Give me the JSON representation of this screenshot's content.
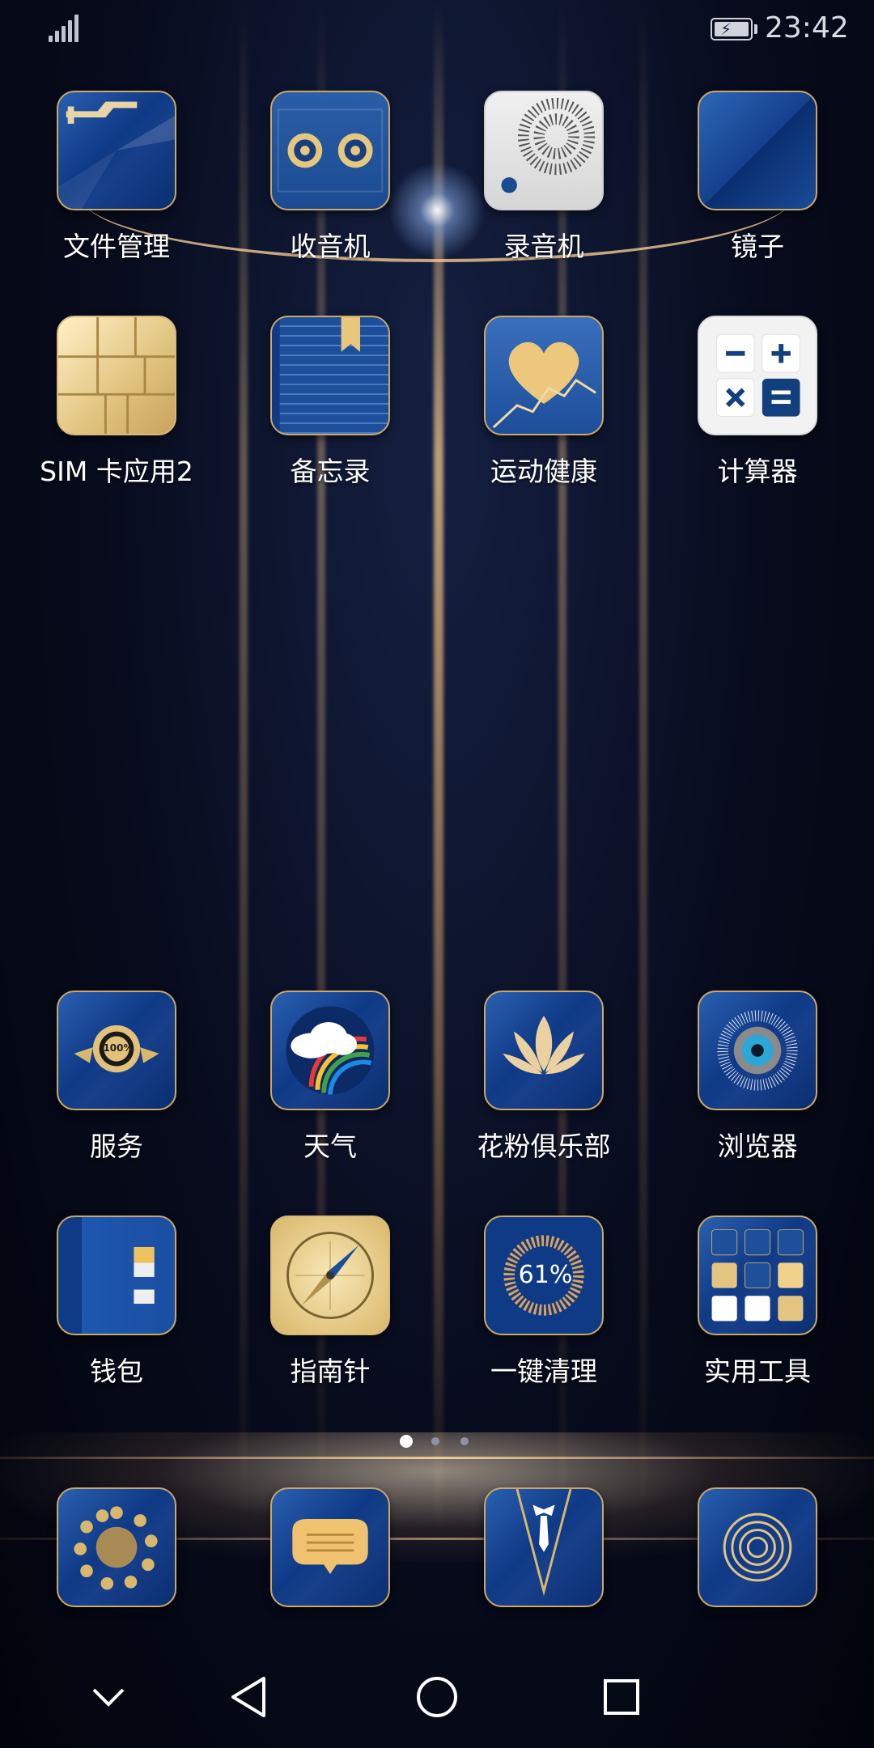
{
  "status_bar": {
    "time": "23:42"
  },
  "apps_row1": [
    {
      "label": "文件管理",
      "icon": "folder-icon"
    },
    {
      "label": "收音机",
      "icon": "radio-icon"
    },
    {
      "label": "录音机",
      "icon": "recorder-icon"
    },
    {
      "label": "镜子",
      "icon": "mirror-icon"
    }
  ],
  "apps_row2": [
    {
      "label": "SIM 卡应用2",
      "icon": "sim-card-icon"
    },
    {
      "label": "备忘录",
      "icon": "notepad-icon"
    },
    {
      "label": "运动健康",
      "icon": "heart-health-icon"
    },
    {
      "label": "计算器",
      "icon": "calculator-icon"
    }
  ],
  "apps_row3": [
    {
      "label": "服务",
      "icon": "service-badge-icon",
      "badge_text": "100%"
    },
    {
      "label": "天气",
      "icon": "weather-icon"
    },
    {
      "label": "花粉俱乐部",
      "icon": "lotus-icon"
    },
    {
      "label": "浏览器",
      "icon": "browser-eye-icon"
    }
  ],
  "apps_row4": [
    {
      "label": "钱包",
      "icon": "wallet-icon"
    },
    {
      "label": "指南针",
      "icon": "compass-icon"
    },
    {
      "label": "一键清理",
      "icon": "cleaner-icon",
      "percent_text": "61%"
    },
    {
      "label": "实用工具",
      "icon": "tools-folder-icon"
    }
  ],
  "dock": [
    {
      "name": "phone-dial-icon"
    },
    {
      "name": "messages-icon"
    },
    {
      "name": "contacts-icon"
    },
    {
      "name": "camera-icon"
    }
  ],
  "pages": {
    "count": 3,
    "active": 0
  },
  "colors": {
    "icon_blue": "#0f3a86",
    "gold": "#c9a86a",
    "label": "#ffffff"
  }
}
